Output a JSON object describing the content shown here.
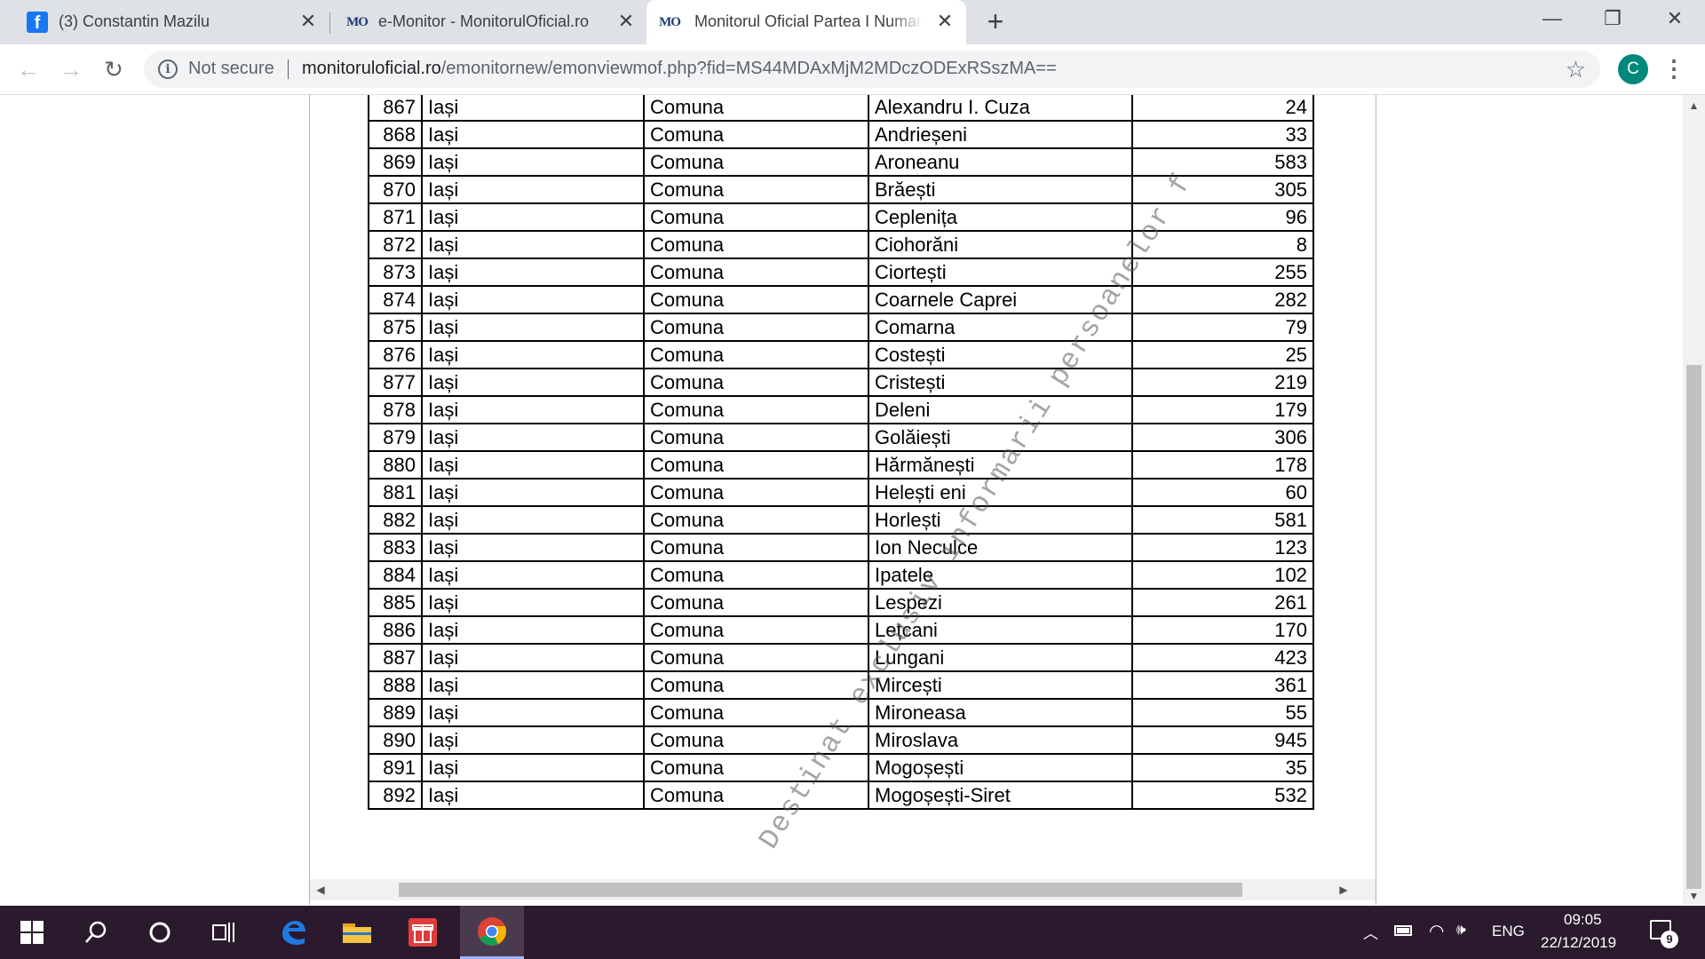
{
  "browser": {
    "tabs": [
      {
        "title": "(3) Constantin Mazilu",
        "icon": "facebook-icon",
        "active": false
      },
      {
        "title": "e-Monitor - MonitorulOficial.ro",
        "icon": "monitorul-oficial-icon",
        "active": false
      },
      {
        "title": "Monitorul Oficial Partea I Numar",
        "icon": "monitorul-oficial-icon",
        "active": true
      }
    ],
    "new_tab_label": "+",
    "security_label": "Not secure",
    "url_host": "monitoruloficial.ro",
    "url_path": "/emonitornew/emonviewmof.php?fid=MS44MDAxMjM2MDczODExRSszMA==",
    "profile_initial": "C",
    "accent_color": "#00897b"
  },
  "document": {
    "watermark": "Destinat exclusiv informarii persoanelor f",
    "rows": [
      {
        "nr": "867",
        "judet": "Iași",
        "tip": "Comuna",
        "localitate": "Alexandru I. Cuza",
        "valoare": "24"
      },
      {
        "nr": "868",
        "judet": "Iași",
        "tip": "Comuna",
        "localitate": "Andrieșeni",
        "valoare": "33"
      },
      {
        "nr": "869",
        "judet": "Iași",
        "tip": "Comuna",
        "localitate": "Aroneanu",
        "valoare": "583"
      },
      {
        "nr": "870",
        "judet": "Iași",
        "tip": "Comuna",
        "localitate": "Brăești",
        "valoare": "305"
      },
      {
        "nr": "871",
        "judet": "Iași",
        "tip": "Comuna",
        "localitate": "Ceplenița",
        "valoare": "96"
      },
      {
        "nr": "872",
        "judet": "Iași",
        "tip": "Comuna",
        "localitate": "Ciohorăni",
        "valoare": "8"
      },
      {
        "nr": "873",
        "judet": "Iași",
        "tip": "Comuna",
        "localitate": "Ciortești",
        "valoare": "255"
      },
      {
        "nr": "874",
        "judet": "Iași",
        "tip": "Comuna",
        "localitate": "Coarnele Caprei",
        "valoare": "282"
      },
      {
        "nr": "875",
        "judet": "Iași",
        "tip": "Comuna",
        "localitate": "Comarna",
        "valoare": "79"
      },
      {
        "nr": "876",
        "judet": "Iași",
        "tip": "Comuna",
        "localitate": "Costești",
        "valoare": "25"
      },
      {
        "nr": "877",
        "judet": "Iași",
        "tip": "Comuna",
        "localitate": "Cristești",
        "valoare": "219"
      },
      {
        "nr": "878",
        "judet": "Iași",
        "tip": "Comuna",
        "localitate": "Deleni",
        "valoare": "179"
      },
      {
        "nr": "879",
        "judet": "Iași",
        "tip": "Comuna",
        "localitate": "Golăiești",
        "valoare": "306"
      },
      {
        "nr": "880",
        "judet": "Iași",
        "tip": "Comuna",
        "localitate": "Hărmănești",
        "valoare": "178"
      },
      {
        "nr": "881",
        "judet": "Iași",
        "tip": "Comuna",
        "localitate": "Helești eni",
        "valoare": "60"
      },
      {
        "nr": "882",
        "judet": "Iași",
        "tip": "Comuna",
        "localitate": "Horlești",
        "valoare": "581"
      },
      {
        "nr": "883",
        "judet": "Iași",
        "tip": "Comuna",
        "localitate": "Ion Neculce",
        "valoare": "123"
      },
      {
        "nr": "884",
        "judet": "Iași",
        "tip": "Comuna",
        "localitate": "Ipatele",
        "valoare": "102"
      },
      {
        "nr": "885",
        "judet": "Iași",
        "tip": "Comuna",
        "localitate": "Lespezi",
        "valoare": "261"
      },
      {
        "nr": "886",
        "judet": "Iași",
        "tip": "Comuna",
        "localitate": "Lețcani",
        "valoare": "170"
      },
      {
        "nr": "887",
        "judet": "Iași",
        "tip": "Comuna",
        "localitate": "Lungani",
        "valoare": "423"
      },
      {
        "nr": "888",
        "judet": "Iași",
        "tip": "Comuna",
        "localitate": "Mircești",
        "valoare": "361"
      },
      {
        "nr": "889",
        "judet": "Iași",
        "tip": "Comuna",
        "localitate": "Mironeasa",
        "valoare": "55"
      },
      {
        "nr": "890",
        "judet": "Iași",
        "tip": "Comuna",
        "localitate": "Miroslava",
        "valoare": "945"
      },
      {
        "nr": "891",
        "judet": "Iași",
        "tip": "Comuna",
        "localitate": "Mogoșești",
        "valoare": "35"
      },
      {
        "nr": "892",
        "judet": "Iași",
        "tip": "Comuna",
        "localitate": "Mogoșești-Siret",
        "valoare": "532"
      }
    ]
  },
  "taskbar": {
    "apps": [
      "windows-start-icon",
      "search-icon",
      "cortana-icon",
      "task-view-icon",
      "edge-icon",
      "file-explorer-icon",
      "gift-app-icon",
      "chrome-icon"
    ],
    "language": "ENG",
    "time": "09:05",
    "date": "22/12/2019",
    "notification_count": "9"
  }
}
